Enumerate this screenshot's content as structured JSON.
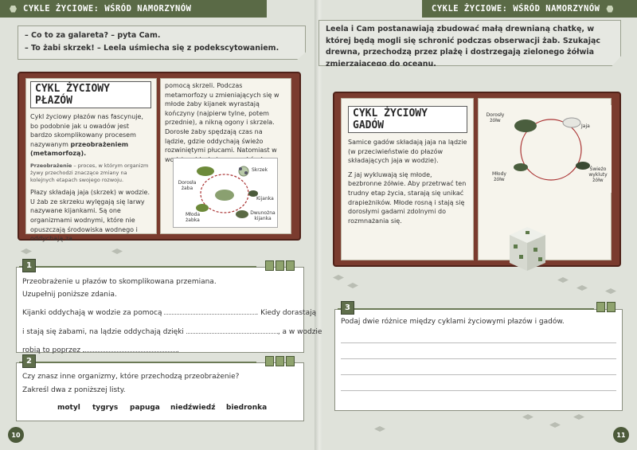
{
  "header": {
    "left_title": "CYKLE ŻYCIOWE: WŚRÓD NAMORZYNÓW",
    "right_title": "CYKLE ŻYCIOWE: WŚRÓD NAMORZYNÓW"
  },
  "left_page": {
    "dialog": [
      "– Co to za galareta? – pyta Cam.",
      "– To żabi skrzek! – Leela uśmiecha się z podekscytowaniem."
    ],
    "book": {
      "title": "CYKL ŻYCIOWY PŁAZÓW",
      "intro_part1": "Cykl życiowy płazów nas fascynuje, bo podobnie jak u owadów jest bardzo skomplikowany procesem nazywanym",
      "intro_bold": "przeobrażeniem (metamorfozą).",
      "definition_term": "Przeobrażenie",
      "definition_text": "– proces, w którym organizm żywy przechodzi znaczące zmiany na kolejnych etapach swojego rozwoju.",
      "col1_para": "Płazy składają jaja (skrzek) w wodzie. U żab ze skrzeku wylęgają się larwy nazywane kijankami. Są one organizmami wodnymi, które nie opuszczają środowiska wodnego i oddychają za",
      "col2_para": "pomocą skrzeli. Podczas metamorfozy u zmieniających się w młode żaby kijanek wyrastają kończyny (najpierw tylne, potem przednie), a nikną ogony i skrzela. Dorosłe żaby spędzają czas na lądzie, gdzie oddychają świeżo rozwiniętymi płucami. Natomiast w wodzie oddychają przez skórę!",
      "diagram_labels": {
        "adult": "Dorosła żaba",
        "spawn": "Skrzek",
        "tadpole": "Kijanka",
        "young": "Młoda żabka",
        "legged": "Dwunożna kijanka"
      }
    },
    "task1": {
      "number": "1",
      "line1": "Przeobrażenie u płazów to skomplikowana przemiana.",
      "line2": "Uzupełnij poniższe zdania.",
      "s1_a": "Kijanki oddychają w wodzie za pomocą",
      "s1_b": ". Kiedy dorastają",
      "s2_a": "i stają się żabami, na lądzie oddychają dzięki",
      "s2_b": ", a w wodzie",
      "s3_a": "robią to poprzez",
      "s3_b": "."
    },
    "task2": {
      "number": "2",
      "line1": "Czy znasz inne organizmy, które przechodzą przeobrażenie?",
      "line2": "Zakreśl dwa z poniższej listy.",
      "words": [
        "motyl",
        "tygrys",
        "papuga",
        "niedźwiedź",
        "biedronka"
      ]
    },
    "page_number": "10"
  },
  "right_page": {
    "intro": "Leela i Cam postanawiają zbudować małą drewnianą chatkę, w której będą mogli się schronić podczas obserwacji żab. Szukając drewna, przechodzą przez plażę i dostrzegają zielonego żółwia zmierzającego do oceanu.",
    "book": {
      "title": "CYKL ŻYCIOWY GADÓW",
      "para1": "Samice gadów składają jaja na lądzie (w przeciwieństwie do płazów składających jaja w wodzie).",
      "para2": "Z jaj wykluwają się młode, bezbronne żółwie. Aby przetrwać ten trudny etap życia, starają się unikać drapieżników. Młode rosną i stają się dorosłymi gadami zdolnymi do rozmnażania się.",
      "diagram_labels": {
        "adult": "Dorosły żółw",
        "eggs": "Jaja",
        "hatched": "Świeżo wykluty żółw",
        "young": "Młody żółw"
      }
    },
    "task3": {
      "number": "3",
      "line1": "Podaj dwie różnice między cyklami życiowymi płazów i gadów."
    },
    "page_number": "11"
  },
  "colors": {
    "header_bar": "#5a6a46",
    "book_cover": "#7a3b2e",
    "page_bg": "#dfe2da",
    "accent": "#6b7a55"
  }
}
